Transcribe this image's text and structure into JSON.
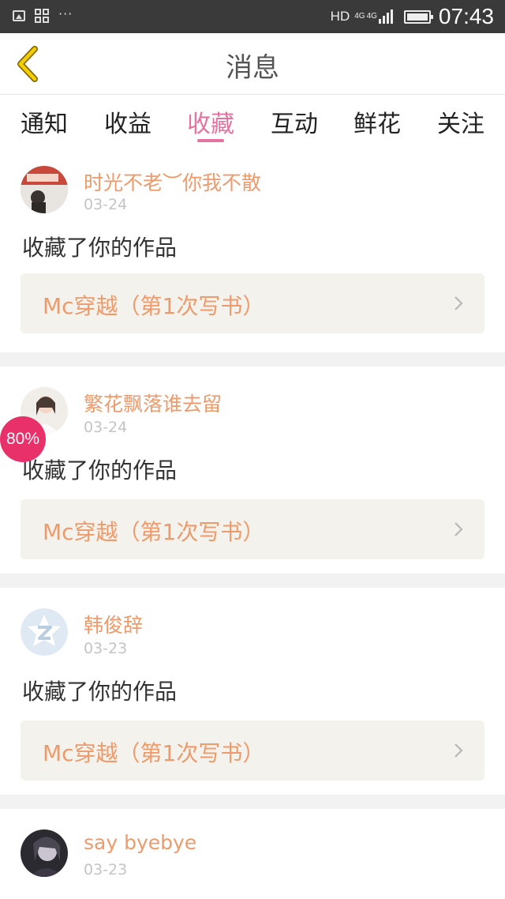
{
  "status_bar": {
    "network": "HD",
    "net_type_1": "4G",
    "net_type_2": "4G",
    "time": "07:43",
    "icons": [
      "image-icon",
      "apps-icon",
      "more-dots-icon",
      "signal-icon",
      "battery-icon"
    ]
  },
  "header": {
    "title": "消息",
    "back_icon": "chevron-left-icon",
    "accent_color": "#e8c200"
  },
  "tabs": [
    {
      "label": "通知",
      "active": false
    },
    {
      "label": "收益",
      "active": false
    },
    {
      "label": "收藏",
      "active": true
    },
    {
      "label": "互动",
      "active": false
    },
    {
      "label": "鲜花",
      "active": false
    },
    {
      "label": "关注",
      "active": false
    }
  ],
  "colors": {
    "tab_active": "#e573a0",
    "username": "#ee9a6a",
    "work_bg": "#f4f2ec",
    "badge": "#e8306a"
  },
  "messages": [
    {
      "username": "时光不老︶你我不散",
      "date": "03-24",
      "action": "收藏了你的作品",
      "work_title": "Mc穿越（第1次写书）"
    },
    {
      "username": "繁花飘落谁去留",
      "date": "03-24",
      "action": "收藏了你的作品",
      "work_title": "Mc穿越（第1次写书）"
    },
    {
      "username": "韩俊辞",
      "date": "03-23",
      "action": "收藏了你的作品",
      "work_title": "Mc穿越（第1次写书）"
    },
    {
      "username": "say byebye",
      "date": "03-23"
    }
  ],
  "overlay_badge": {
    "label": "80%",
    "value": 0.8
  }
}
